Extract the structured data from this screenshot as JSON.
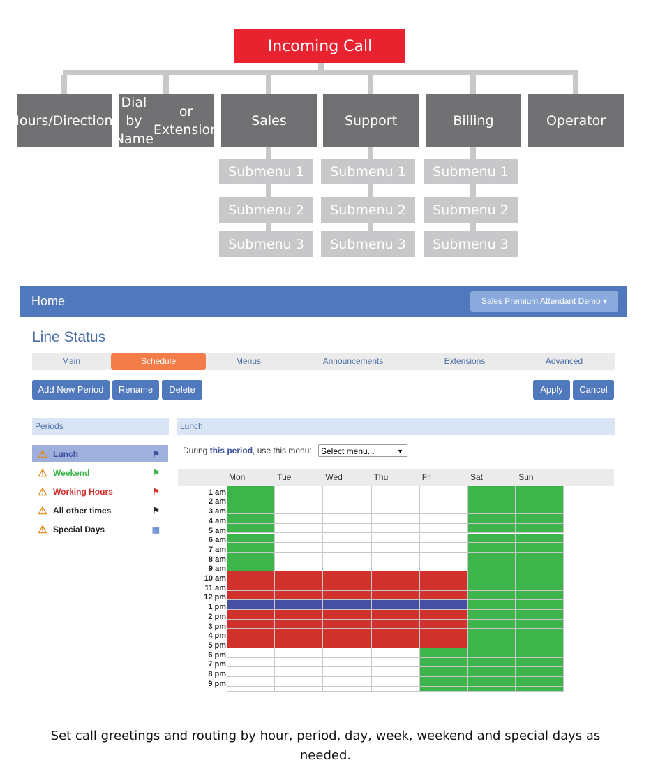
{
  "diagram": {
    "root": "Incoming Call",
    "branches": [
      {
        "label": "Hours/\nDirections",
        "submenus": []
      },
      {
        "label": "Dial by Name\nor Extension",
        "submenus": []
      },
      {
        "label": "Sales",
        "submenus": [
          "Submenu 1",
          "Submenu 2",
          "Submenu 3"
        ]
      },
      {
        "label": "Support",
        "submenus": [
          "Submenu 1",
          "Submenu 2",
          "Submenu 3"
        ]
      },
      {
        "label": "Billing",
        "submenus": [
          "Submenu 1",
          "Submenu 2",
          "Submenu 3"
        ]
      },
      {
        "label": "Operator",
        "submenus": []
      }
    ],
    "colors": {
      "root": "#e8232f",
      "branch": "#717073",
      "submenu": "#c8c7c9"
    }
  },
  "app": {
    "navbar": {
      "title": "Home",
      "account": "Sales Premium Attendant Demo"
    },
    "page_title": "Line Status",
    "tabs": [
      {
        "label": "Main"
      },
      {
        "label": "Schedule",
        "active": true
      },
      {
        "label": "Menus"
      },
      {
        "label": "Announcements"
      },
      {
        "label": "Extensions"
      },
      {
        "label": "Advanced"
      }
    ],
    "buttons": {
      "add": "Add New Period",
      "rename": "Rename",
      "delete": "Delete",
      "apply": "Apply",
      "cancel": "Cancel"
    },
    "periods": {
      "header": "Periods",
      "items": [
        {
          "label": "Lunch",
          "color": "#3b4fa0",
          "icon": "flag-icon",
          "selected": true
        },
        {
          "label": "Weekend",
          "color": "#3db54a",
          "icon": "flag-icon"
        },
        {
          "label": "Working Hours",
          "color": "#d0312d",
          "icon": "flag-icon"
        },
        {
          "label": "All other times",
          "color": "#222222",
          "icon": "flag-icon"
        },
        {
          "label": "Special Days",
          "color": "#222222",
          "icon": "calendar-icon"
        }
      ]
    },
    "detail": {
      "header": "Lunch",
      "menu_prefix": "During ",
      "menu_em": "this period",
      "menu_suffix": ", use this menu:",
      "menu_select": "Select menu..."
    },
    "schedule": {
      "days": [
        "Mon",
        "Tue",
        "Wed",
        "Thu",
        "Fri",
        "Sat",
        "Sun"
      ],
      "hours": [
        "1 am",
        "2 am",
        "3 am",
        "4 am",
        "5 am",
        "6 am",
        "7 am",
        "8 am",
        "9 am",
        "10 am",
        "11 am",
        "12 pm",
        "1 pm",
        "2 pm",
        "3 pm",
        "4 pm",
        "5 pm",
        "6 pm",
        "7 pm",
        "8 pm",
        "9 pm"
      ],
      "legend": {
        "G": "#3db54a",
        "R": "#d0312d",
        "B": "#4550a3",
        "W": "#ffffff"
      },
      "grid": {
        "Mon": "GGGGGGGGGRRRBRRRRWWWWW",
        "Tue": "WWWWWWWWWRRRBRRRRWWWWW",
        "Wed": "WWWWWWWWWRRRBRRRRWWWWW",
        "Thu": "WWWWWWWWWRRRBRRRRWWWWW",
        "Fri": "WWWWWWWWWRRRBRRRRGGGGG",
        "Sat": "GGGGGGGGGGGGGGGGGGGGGG",
        "Sun": "GGGGGGGGGGGGGGGGGGGGGG"
      }
    }
  },
  "caption": "Set call greetings and routing by hour, period, day, week, weekend and special days as needed."
}
